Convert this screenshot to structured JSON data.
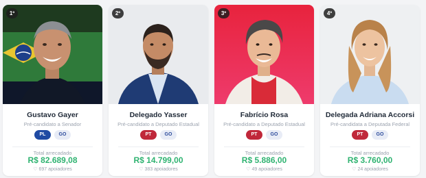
{
  "cards": [
    {
      "rank": "1º",
      "name": "Gustavo Gayer",
      "role": "Pré-candidato a Senador",
      "party": "PL",
      "party_color": "#1f4aa3",
      "state": "GO",
      "total_label": "Total arrecadado",
      "amount": "R$ 82.689,08",
      "supporters": "697 apoiadores"
    },
    {
      "rank": "2º",
      "name": "Delegado Yasser",
      "role": "Pré-candidato a Deputado Estadual",
      "party": "PT",
      "party_color": "#c0283a",
      "state": "GO",
      "total_label": "Total arrecadado",
      "amount": "R$ 14.799,00",
      "supporters": "383 apoiadores"
    },
    {
      "rank": "3º",
      "name": "Fabrício Rosa",
      "role": "Pré-candidato a Deputado Estadual",
      "party": "PT",
      "party_color": "#c0283a",
      "state": "GO",
      "total_label": "Total arrecadado",
      "amount": "R$ 5.886,00",
      "supporters": "49 apoiadores"
    },
    {
      "rank": "4º",
      "name": "Delegada Adriana Accorsi",
      "role": "Pré-candidata a Deputada Federal",
      "party": "PT",
      "party_color": "#c0283a",
      "state": "GO",
      "total_label": "Total arrecadado",
      "amount": "R$ 3.760,00",
      "supporters": "24 apoiadores"
    }
  ],
  "colors": {
    "amount_green": "#2fb371",
    "state_tag_bg": "#e8ecf6",
    "state_tag_text": "#2b4a9b"
  },
  "icons": {
    "supporters": "heart-icon"
  }
}
